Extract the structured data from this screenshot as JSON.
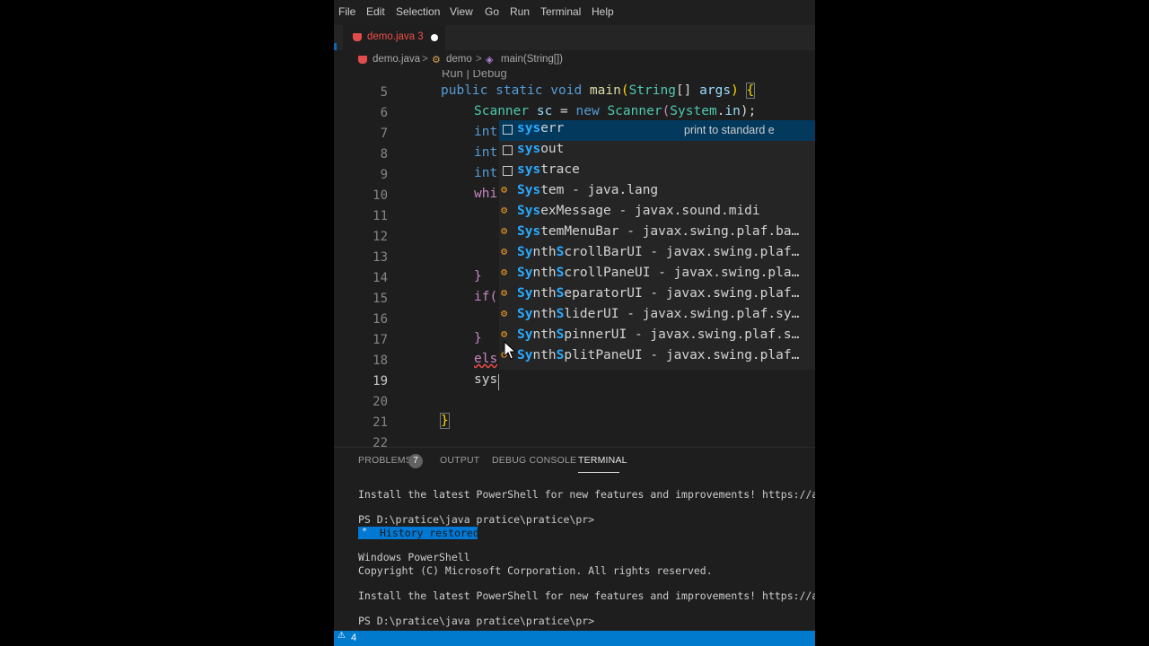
{
  "menu": [
    "File",
    "Edit",
    "Selection",
    "View",
    "Go",
    "Run",
    "Terminal",
    "Help"
  ],
  "tab": {
    "label": "demo.java 3"
  },
  "breadcrumb": {
    "file": "demo.java",
    "sep": ">",
    "cls": "demo",
    "method": "main(String[])"
  },
  "editor": {
    "codelens": "Run | Debug",
    "line_numbers": [
      "5",
      "6",
      "7",
      "8",
      "9",
      "10",
      "11",
      "12",
      "13",
      "14",
      "15",
      "16",
      "17",
      "18",
      "19",
      "20",
      "21",
      "22"
    ],
    "code": {
      "l5_public": "public",
      "l5_static": "static",
      "l5_void": "void",
      "l5_main": "main",
      "l5_string": "String",
      "l5_brackets": "[]",
      "l5_args": "args",
      "l6_scanner": "Scanner",
      "l6_sc": "sc",
      "l6_eq": "=",
      "l6_new": "new",
      "l6_scanner2": "Scanner",
      "l6_system": "System",
      "l6_dot": ".",
      "l6_in": "in",
      "l6_end": ");",
      "l7": "int",
      "l8": "int",
      "l9": "int",
      "l10": "whi",
      "l14": "}",
      "l15": "if(",
      "l17": "}",
      "l18": "els",
      "l19": "sys",
      "l21": "}"
    }
  },
  "suggest": {
    "items": [
      {
        "match": "sys",
        "rest": "err",
        "detail": "print to standard e"
      },
      {
        "match": "sys",
        "rest": "out"
      },
      {
        "match": "sys",
        "rest": "trace"
      },
      {
        "match": "Sys",
        "rest": "tem - java.lang"
      },
      {
        "match": "Sys",
        "rest": "exMessage - javax.sound.midi"
      },
      {
        "match": "Sys",
        "rest": "temMenuBar - javax.swing.plaf.ba…"
      },
      {
        "match": "Sy",
        "rest": "nth",
        "match2": "S",
        "rest2": "crollBarUI - javax.swing.plaf…"
      },
      {
        "match": "Sy",
        "rest": "nth",
        "match2": "S",
        "rest2": "crollPaneUI - javax.swing.pla…"
      },
      {
        "match": "Sy",
        "rest": "nth",
        "match2": "S",
        "rest2": "eparatorUI - javax.swing.plaf…"
      },
      {
        "match": "Sy",
        "rest": "nth",
        "match2": "S",
        "rest2": "liderUI - javax.swing.plaf.sy…"
      },
      {
        "match": "Sy",
        "rest": "nth",
        "match2": "S",
        "rest2": "pinnerUI - javax.swing.plaf.s…"
      },
      {
        "match": "Sy",
        "rest": "nth",
        "match2": "S",
        "rest2": "plitPaneUI - javax.swing.plaf…"
      }
    ]
  },
  "panel": {
    "tabs": [
      "PROBLEMS",
      "OUTPUT",
      "DEBUG CONSOLE",
      "TERMINAL"
    ],
    "problems_count": "7",
    "terminal_lines": [
      "Install the latest PowerShell for new features and improvements! https://aka.ms/",
      "PS D:\\pratice\\java pratice\\pratice\\pr>",
      "History restored",
      "Windows PowerShell",
      "Copyright (C) Microsoft Corporation. All rights reserved.",
      "Install the latest PowerShell for new features and improvements! https://aka.ms/",
      "PS D:\\pratice\\java pratice\\pratice\\pr>"
    ]
  },
  "status": {
    "warning_count": "4"
  }
}
